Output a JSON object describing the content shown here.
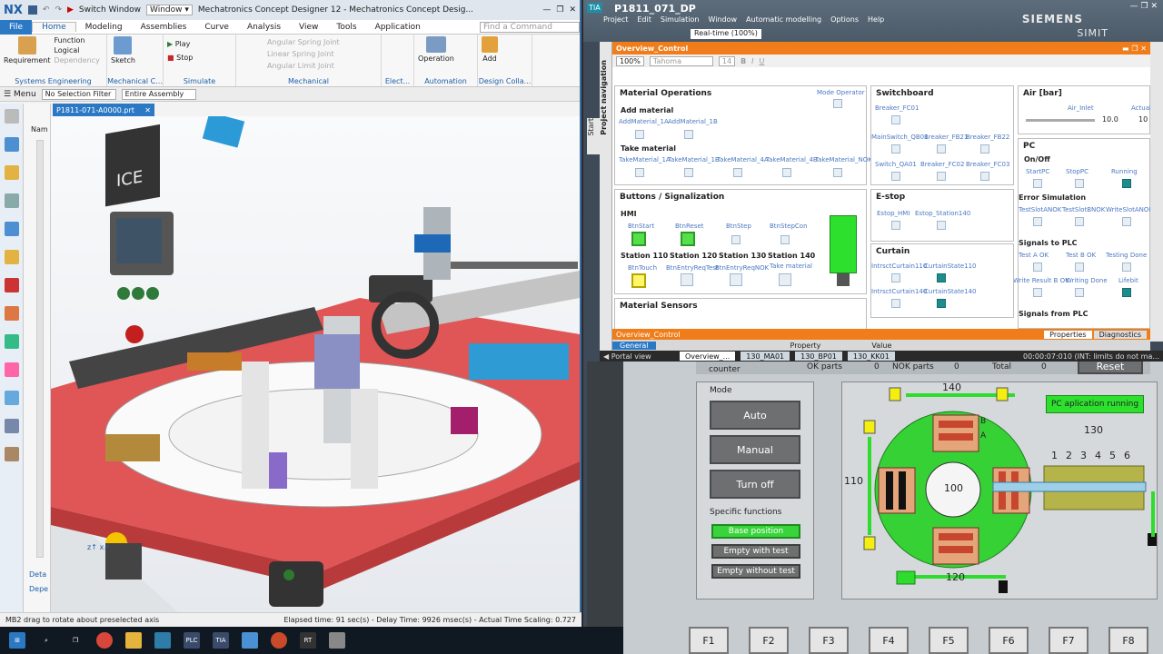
{
  "nx": {
    "logo": "NX",
    "switch_window": "Switch Window",
    "window_menu": "Window ▾",
    "title": "Mechatronics Concept Designer 12 - Mechatronics Concept Desig...",
    "menu": [
      "File",
      "Home",
      "Modeling",
      "Assemblies",
      "Curve",
      "Analysis",
      "View",
      "Tools",
      "Application"
    ],
    "search_placeholder": "Find a Command",
    "ribbon": {
      "requirement": "Requirement",
      "function": "Function",
      "logical": "Logical",
      "dependency": "Dependency",
      "sketch": "Sketch",
      "play": "Play",
      "stop": "Stop",
      "angular_spring": "Angular Spring Joint",
      "linear_spring": "Linear Spring Joint",
      "angular_limit": "Angular Limit Joint",
      "operation": "Operation",
      "add": "Add",
      "groups": [
        "Systems Engineering",
        "Mechanical C...",
        "Simulate",
        "Mechanical",
        "Elect...",
        "Automation",
        "Design Colla..."
      ]
    },
    "menu_btn": "Menu",
    "filter": "No Selection Filter",
    "assembly": "Entire Assembly",
    "nav_header": "Nam",
    "nav_detail": "Deta",
    "nav_dep": "Depe",
    "part_tab": "P1811-071-A0000.prt",
    "status_left": "MB2 drag to rotate about preselected axis",
    "status_right": "Elapsed time: 91 sec(s) - Delay Time: 9926 msec(s) - Actual Time Scaling: 0.727"
  },
  "tia": {
    "logo": "TIA",
    "title": "P1811_071_DP",
    "menu": [
      "Project",
      "Edit",
      "Simulation",
      "Window",
      "Automatic modelling",
      "Options",
      "Help"
    ],
    "realtime": "Real-time (100%)",
    "siemens": "SIEMENS",
    "simit": "SIMIT",
    "side_nav": "Project navigation",
    "side_start": "Start",
    "overview_title": "Overview_Control",
    "zoom": "100%",
    "font": "Tahoma",
    "font_size": "14",
    "material_ops": {
      "title": "Material Operations",
      "mode_operator": "Mode Operator",
      "add_material": "Add material",
      "add_labels": [
        "AddMaterial_1A",
        "AddMaterial_1B"
      ],
      "take_material": "Take material",
      "take_labels": [
        "TakeMaterial_1A",
        "TakeMaterial_1B",
        "TakeMaterial_4A",
        "TakeMaterial_4B",
        "TakeMaterial_NOK"
      ]
    },
    "switchboard": {
      "title": "Switchboard",
      "labels": [
        "Breaker_FC01",
        "MainSwitch_QB01",
        "Breaker_FB21",
        "Breaker_FB22",
        "Switch_QA01",
        "Breaker_FC02",
        "Breaker_FC03"
      ]
    },
    "air": {
      "title": "Air [bar]",
      "inlet": "Air_Inlet",
      "actual": "Actual Val",
      "val1": "10.0",
      "val2": "10"
    },
    "pc": {
      "title": "PC",
      "onoff": "On/Off",
      "labels": [
        "StartPC",
        "StopPC",
        "Running"
      ],
      "error_sim": "Error Simulation",
      "error_labels": [
        "TestSlotANOK",
        "TestSlotBNOK",
        "WriteSlotANOK"
      ],
      "signals_to": "Signals to PLC",
      "to_labels": [
        "Test A OK",
        "Test B OK",
        "Testing Done",
        "Write Result B OK",
        "Writing Done",
        "Lifebit"
      ],
      "signals_from": "Signals from PLC"
    },
    "buttons": {
      "title": "Buttons / Signalization",
      "hmi": "HMI",
      "hmi_labels": [
        "BtnStart",
        "BtnReset",
        "BtnStep",
        "BtnStepCon"
      ],
      "stations": [
        "Station 110",
        "Station 120",
        "Station 130",
        "Station 140"
      ],
      "st_labels": [
        "BtnTouch",
        "BtnEntryReqTest",
        "BtnEntryReqNOK",
        "Take material"
      ]
    },
    "estop": {
      "title": "E-stop",
      "labels": [
        "Estop_HMI",
        "Estop_Station140"
      ]
    },
    "curtain": {
      "title": "Curtain",
      "labels": [
        "IntrsctCurtain110",
        "CurtainState110",
        "IntrsctCurtain140",
        "CurtainState140"
      ]
    },
    "material_sensors": "Material Sensors",
    "props_bar": "Overview_Control",
    "props_tabs": [
      "Properties",
      "Diagnostics"
    ],
    "props_cols": [
      "General",
      "Property",
      "Value"
    ],
    "portal_view": "◀  Portal view",
    "portal_tabs": [
      "Overview_...",
      "130_MA01",
      "130_BP01",
      "130_KK01"
    ],
    "portal_status": "00:00:07:010  (INT: limits do not ma..."
  },
  "hmi": {
    "counter": "counter",
    "ok_parts": "OK parts",
    "ok_val": "0",
    "nok_parts": "NOK parts",
    "nok_val": "0",
    "total": "Total",
    "total_val": "0",
    "reset": "Reset",
    "mode": "Mode",
    "auto": "Auto",
    "manual": "Manual",
    "turn_off": "Turn off",
    "specific": "Specific functions",
    "base_position": "Base position",
    "empty_test": "Empty with test",
    "empty_no_test": "Empty without test",
    "pc_running": "PC aplication running",
    "st140": "140",
    "st130": "130",
    "st120": "120",
    "st110": "110",
    "center": "100",
    "slots": [
      "1",
      "2",
      "3",
      "4",
      "5",
      "6"
    ],
    "ab": [
      "A",
      "B"
    ],
    "fkeys": [
      "F1",
      "F2",
      "F3",
      "F4",
      "F5",
      "F6",
      "F7",
      "F8"
    ]
  },
  "colors": {
    "nx_blue": "#2b78c5",
    "tia_orange": "#f07d1a",
    "hmi_green": "#39d43b",
    "hmi_red": "#c8462e"
  }
}
